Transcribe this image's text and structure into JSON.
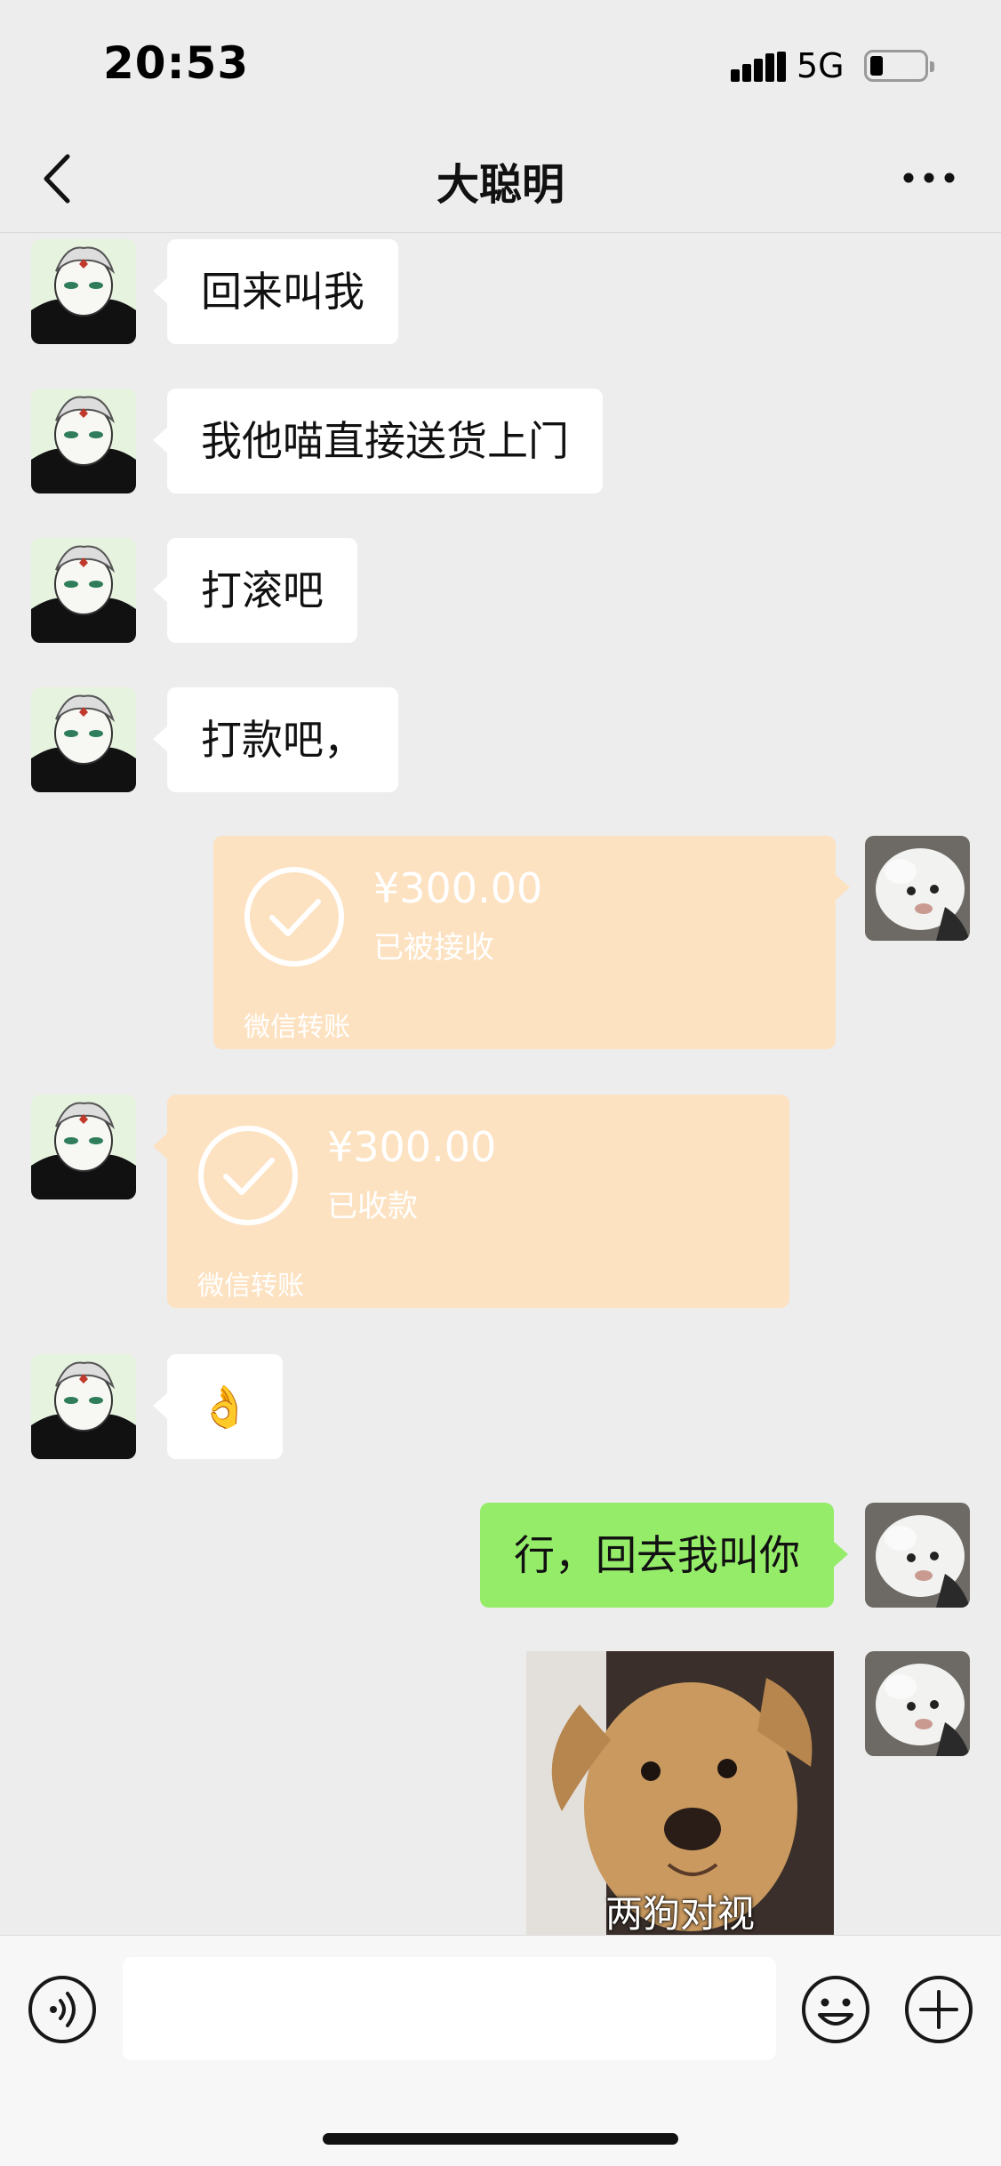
{
  "status_bar": {
    "time": "20:53",
    "network": "5G"
  },
  "nav": {
    "title": "大聪明"
  },
  "messages": [
    {
      "side": "left",
      "type": "text",
      "text": "回来叫我"
    },
    {
      "side": "left",
      "type": "text",
      "text": "我他喵直接送货上门"
    },
    {
      "side": "left",
      "type": "text",
      "text": "打滚吧"
    },
    {
      "side": "left",
      "type": "text",
      "text": "打款吧，"
    },
    {
      "side": "right",
      "type": "transfer",
      "amount": "¥300.00",
      "status": "已被接收",
      "label": "微信转账"
    },
    {
      "side": "left",
      "type": "transfer",
      "amount": "¥300.00",
      "status": "已收款",
      "label": "微信转账"
    },
    {
      "side": "left",
      "type": "text",
      "text": "👌"
    },
    {
      "side": "right",
      "type": "text",
      "text": "行，回去我叫你"
    },
    {
      "side": "right",
      "type": "sticker",
      "caption": "两狗对视"
    }
  ],
  "colors": {
    "green_bubble": "#95ec69",
    "transfer_bubble": "#fde2c2",
    "background": "#ededed"
  },
  "icons": {
    "back": "chevron-left-icon",
    "more": "more-dots-icon",
    "voice": "voice-icon",
    "emoji": "emoji-icon",
    "plus": "plus-icon"
  }
}
